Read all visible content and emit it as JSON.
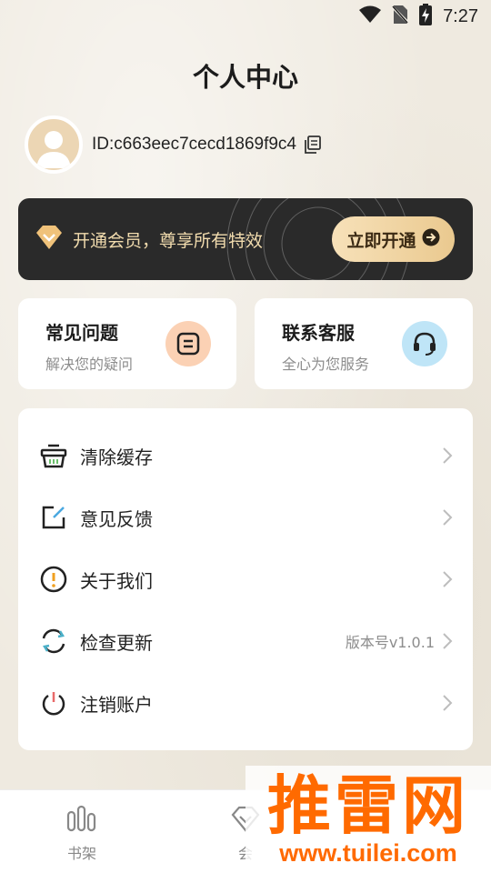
{
  "status_bar": {
    "time": "7:27"
  },
  "page": {
    "title": "个人中心"
  },
  "profile": {
    "user_id": "ID:c663eec7cecd1869f9c4"
  },
  "vip": {
    "text": "开通会员，尊享所有特效",
    "button_label": "立即开通"
  },
  "cards": [
    {
      "title": "常见问题",
      "subtitle": "解决您的疑问",
      "icon": "faq-icon",
      "color": "#fbd1b4"
    },
    {
      "title": "联系客服",
      "subtitle": "全心为您服务",
      "icon": "headset-icon",
      "color": "#bfe5f7"
    }
  ],
  "menu": [
    {
      "label": "清除缓存",
      "icon": "basket-icon",
      "value": ""
    },
    {
      "label": "意见反馈",
      "icon": "edit-icon",
      "value": ""
    },
    {
      "label": "关于我们",
      "icon": "info-icon",
      "value": ""
    },
    {
      "label": "检查更新",
      "icon": "refresh-icon",
      "value": "版本号v1.0.1"
    },
    {
      "label": "注销账户",
      "icon": "power-icon",
      "value": ""
    }
  ],
  "tabs": [
    {
      "label": "书架",
      "icon": "bookshelf-icon"
    },
    {
      "label": "会",
      "icon": "member-icon"
    }
  ],
  "watermark": {
    "logo": "推雷网",
    "url": "www.tuilei.com"
  }
}
